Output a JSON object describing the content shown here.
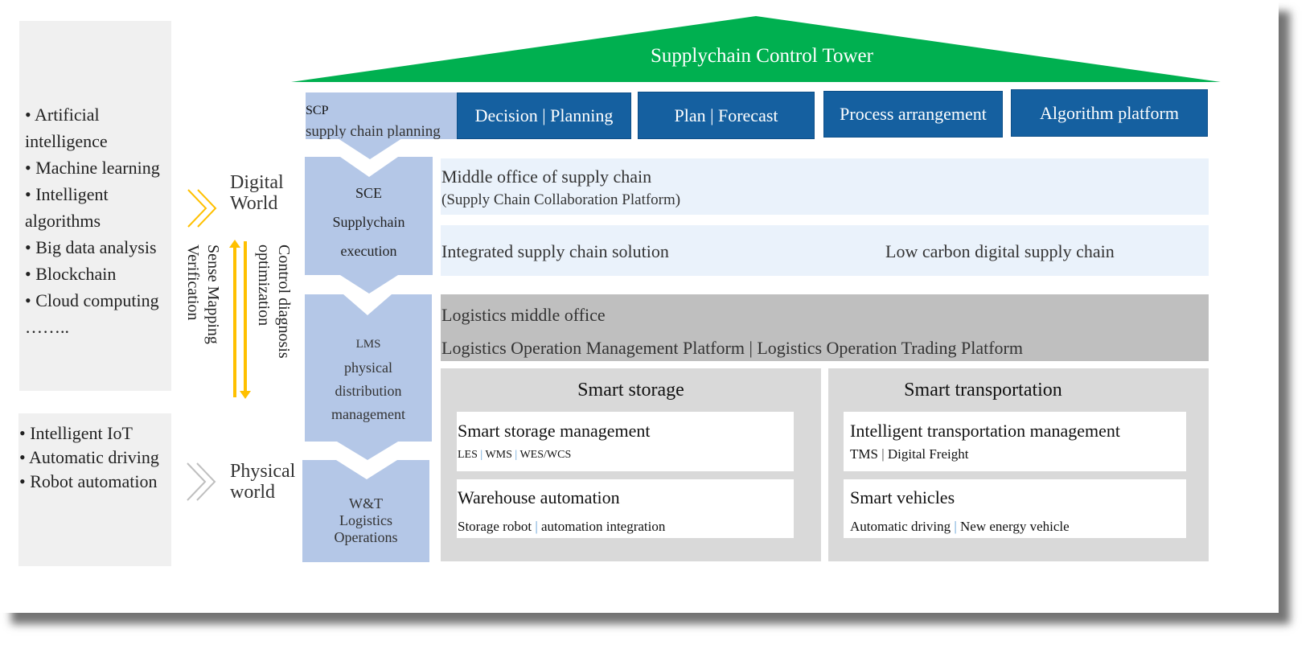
{
  "tower": {
    "title": "Supplychain Control Tower",
    "roof_color": "#00b050"
  },
  "scp": {
    "abbr": "SCP",
    "label": "supply chain planning"
  },
  "tabs": [
    {
      "label": "Decision | Planning"
    },
    {
      "label": "Plan | Forecast"
    },
    {
      "label": "Process arrangement"
    },
    {
      "label": "Algorithm platform"
    }
  ],
  "stages": {
    "sce": {
      "abbr": "SCE",
      "line1": "Supplychain",
      "line2": "execution"
    },
    "lms": {
      "abbr": "LMS",
      "line1": "physical",
      "line2": "distribution",
      "line3": "management"
    },
    "wt": {
      "line1": "W&T",
      "line2": "Logistics",
      "line3": "Operations"
    }
  },
  "supply_chain_middle": {
    "title": "Middle office of supply chain",
    "subtitle": "(Supply Chain Collaboration Platform)"
  },
  "solutions": {
    "left": "Integrated supply chain solution",
    "right": "Low carbon digital supply chain"
  },
  "logistics_middle": {
    "title": "Logistics middle office",
    "subtitle": "Logistics Operation Management Platform | Logistics Operation Trading Platform"
  },
  "smart_storage": {
    "title": "Smart storage",
    "cards": [
      {
        "title": "Smart storage management",
        "items": [
          "LES",
          "WMS",
          "WES/WCS"
        ]
      },
      {
        "title": "Warehouse automation",
        "items": [
          "Storage robot",
          "automation integration"
        ]
      }
    ]
  },
  "smart_transportation": {
    "title": "Smart transportation",
    "cards": [
      {
        "title": "Intelligent transportation management",
        "items": [
          "TMS",
          "Digital Freight"
        ]
      },
      {
        "title": "Smart vehicles",
        "items": [
          "Automatic driving",
          "New energy vehicle"
        ]
      }
    ]
  },
  "digital_tech": {
    "items": [
      "• Artificial",
      "intelligence",
      "• Machine learning",
      "• Intelligent",
      "algorithms",
      "• Big data analysis",
      "• Blockchain",
      "• Cloud computing",
      "…….."
    ]
  },
  "physical_tech": {
    "items": [
      "• Intelligent IoT",
      "• Automatic driving",
      "• Robot automation"
    ]
  },
  "worlds": {
    "digital": {
      "line1": "Digital",
      "line2": "World"
    },
    "physical": {
      "line1": "Physical",
      "line2": "world"
    }
  },
  "feedback": {
    "down_label_1": "Control  diagnosis",
    "down_label_2": "optimization",
    "up_label_1": "Sense Mapping",
    "up_label_2": "Verification",
    "arrow_color": "#ffc000"
  },
  "separator": "|"
}
